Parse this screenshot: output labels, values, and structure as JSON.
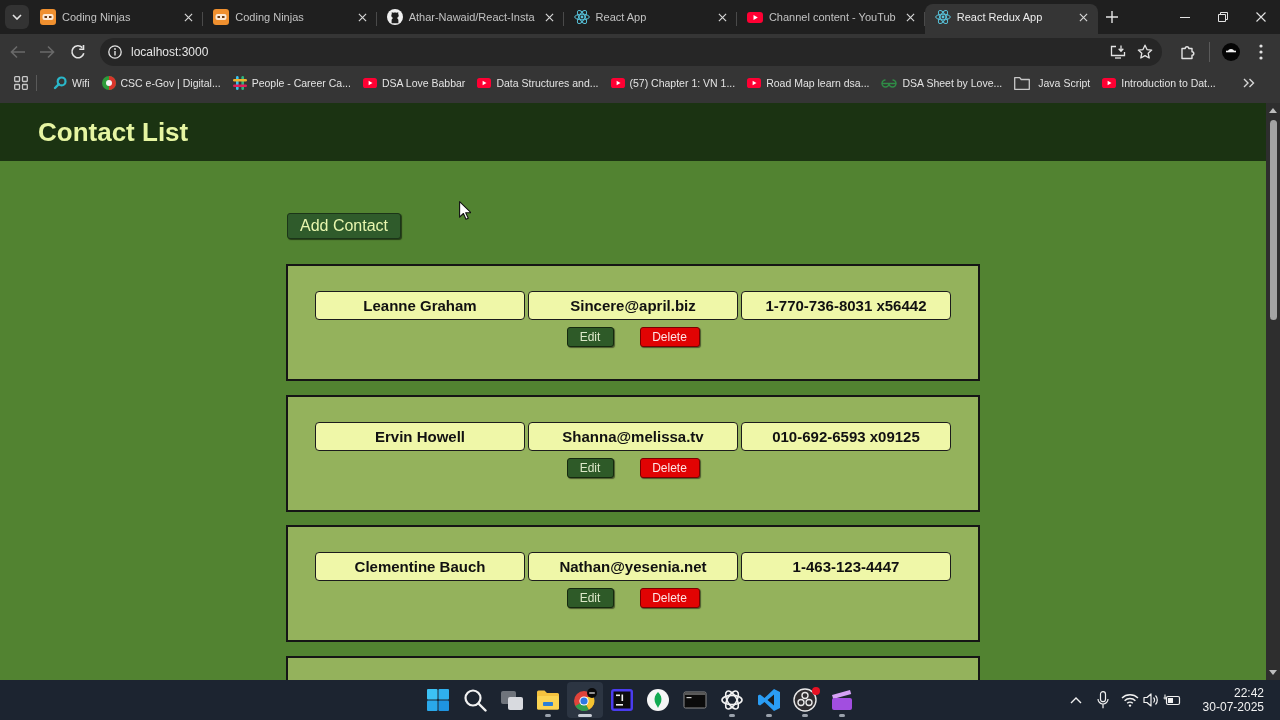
{
  "browser": {
    "tabs": [
      {
        "kind": "ninja",
        "title": "Coding Ninjas",
        "selected": false
      },
      {
        "kind": "ninja",
        "title": "Coding Ninjas",
        "selected": false
      },
      {
        "kind": "cat",
        "title": "Athar-Nawaid/React-Insta",
        "selected": false
      },
      {
        "kind": "atom",
        "title": "React App",
        "selected": false
      },
      {
        "kind": "video",
        "title": "Channel content - YouTub",
        "selected": false
      },
      {
        "kind": "atom",
        "title": "React Redux App",
        "selected": true
      }
    ],
    "nav_buttons": [
      {
        "kind": "back",
        "disabled": true
      },
      {
        "kind": "forward",
        "disabled": true
      },
      {
        "kind": "reload",
        "disabled": false
      }
    ],
    "address_bar": {
      "value": "localhost:3000"
    },
    "bookmarks": [
      {
        "kind": "ring",
        "label": "Wifi"
      },
      {
        "kind": "disc",
        "label": "CSC e-Gov | Digital..."
      },
      {
        "kind": "hash",
        "label": "People - Career Ca..."
      },
      {
        "kind": "video",
        "label": "DSA Love Babbar"
      },
      {
        "kind": "video",
        "label": "Data Structures and..."
      },
      {
        "kind": "video",
        "label": "(57) Chapter 1: VN 1..."
      },
      {
        "kind": "video",
        "label": "Road Map learn dsa..."
      },
      {
        "kind": "links",
        "label": "DSA Sheet by Love..."
      },
      {
        "kind": "folder",
        "label": "Java Script"
      },
      {
        "kind": "video",
        "label": "Introduction to Dat..."
      }
    ]
  },
  "page": {
    "title": "Contact List",
    "add_button": "Add Contact",
    "contacts": [
      {
        "name": "Leanne Graham",
        "email": "Sincere@april.biz",
        "phone": "1-770-736-8031 x56442",
        "actions": [
          {
            "kind": "edit",
            "label": "Edit"
          },
          {
            "kind": "delete",
            "label": "Delete"
          }
        ]
      },
      {
        "name": "Ervin Howell",
        "email": "Shanna@melissa.tv",
        "phone": "010-692-6593 x09125",
        "actions": [
          {
            "kind": "edit",
            "label": "Edit"
          },
          {
            "kind": "delete",
            "label": "Delete"
          }
        ]
      },
      {
        "name": "Clementine Bauch",
        "email": "Nathan@yesenia.net",
        "phone": "1-463-123-4447",
        "actions": [
          {
            "kind": "edit",
            "label": "Edit"
          },
          {
            "kind": "delete",
            "label": "Delete"
          }
        ]
      }
    ],
    "list_continues": true
  },
  "taskbar": {
    "apps": [
      {
        "kind": "start",
        "running": false,
        "selected": false,
        "notification": false
      },
      {
        "kind": "search",
        "running": false,
        "selected": false,
        "notification": false
      },
      {
        "kind": "taskview",
        "running": false,
        "selected": false,
        "notification": false
      },
      {
        "kind": "files",
        "running": true,
        "selected": false,
        "notification": false
      },
      {
        "kind": "browser",
        "running": true,
        "selected": true,
        "notification": false
      },
      {
        "kind": "ide",
        "running": false,
        "selected": false,
        "notification": false
      },
      {
        "kind": "leaf",
        "running": false,
        "selected": false,
        "notification": false
      },
      {
        "kind": "terminal",
        "running": false,
        "selected": false,
        "notification": false
      },
      {
        "kind": "knot",
        "running": true,
        "selected": false,
        "notification": false
      },
      {
        "kind": "ribbon",
        "running": true,
        "selected": false,
        "notification": false
      },
      {
        "kind": "swirl",
        "running": true,
        "selected": false,
        "notification": true
      },
      {
        "kind": "clapper",
        "running": true,
        "selected": false,
        "notification": false
      }
    ],
    "clock": {
      "time": "22:42",
      "date": "30-07-2025"
    }
  }
}
